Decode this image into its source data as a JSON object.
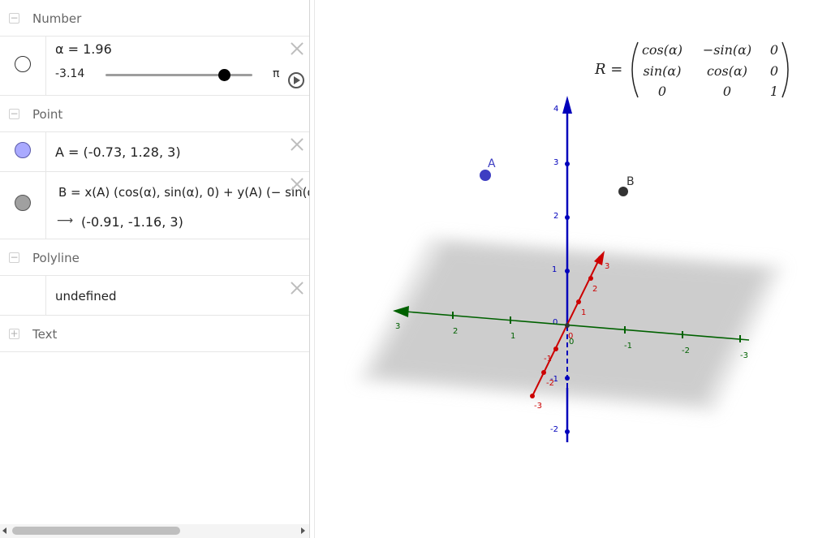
{
  "algebra": {
    "groups": {
      "number": {
        "label": "Number",
        "toggle": "−"
      },
      "point": {
        "label": "Point",
        "toggle": "−"
      },
      "polyline": {
        "label": "Polyline",
        "toggle": "−"
      },
      "text": {
        "label": "Text",
        "toggle": "+"
      }
    },
    "alpha": {
      "text": "α = 1.96",
      "min": "-3.14",
      "max": "π",
      "value": 1.96,
      "range": [
        -3.14,
        3.14
      ]
    },
    "point_a": {
      "text": "A = (-0.73, 1.28, 3)",
      "color": "#aaaaff"
    },
    "point_b": {
      "definition": "B = x(A) (cos(α), sin(α), 0) + y(A) (− sin(α",
      "arrow": "⟶",
      "value": "(-0.91, -1.16, 3)",
      "color": "#a0a0a0"
    },
    "polyline": {
      "value": "undefined"
    }
  },
  "graphics": {
    "matrix": {
      "lhs": "R =",
      "rows": [
        [
          "cos(α)",
          "−sin(α)",
          "0"
        ],
        [
          "sin(α)",
          "cos(α)",
          "0"
        ],
        [
          "0",
          "0",
          "1"
        ]
      ]
    },
    "points": {
      "a_label": "A",
      "b_label": "B",
      "a_color": "#3d3dc2",
      "b_color": "#333333"
    },
    "axes": {
      "x_color": "#cc0000",
      "y_color": "#006100",
      "z_color": "#0000bb",
      "x_ticks": [
        "3",
        "2",
        "1",
        "0",
        "-1",
        "-2",
        "-3"
      ],
      "y_ticks": [
        "3",
        "2",
        "1",
        "0",
        "-1",
        "-2",
        "-3"
      ],
      "z_ticks": [
        "4",
        "3",
        "2",
        "1",
        "0",
        "-1",
        "-2"
      ]
    }
  }
}
